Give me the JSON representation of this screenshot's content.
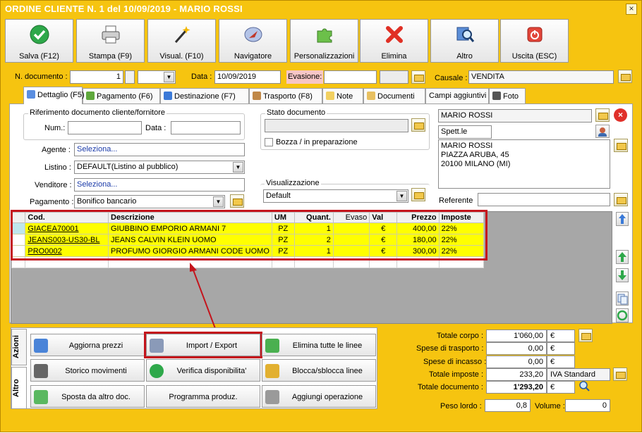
{
  "window": {
    "title": "ORDINE CLIENTE N. 1 del 10/09/2019 - MARIO ROSSI",
    "close": "×"
  },
  "toolbar": [
    {
      "label": "Salva (F12)",
      "icon": "check-icon"
    },
    {
      "label": "Stampa (F9)",
      "icon": "printer-icon"
    },
    {
      "label": "Visual. (F10)",
      "icon": "magic-wand-icon"
    },
    {
      "label": "Navigatore",
      "icon": "compass-icon"
    },
    {
      "label": "Personalizzazioni",
      "icon": "puzzle-icon"
    },
    {
      "label": "Elimina",
      "icon": "delete-x-icon"
    },
    {
      "label": "Altro",
      "icon": "magnifier-icon"
    },
    {
      "label": "Uscita (ESC)",
      "icon": "power-icon"
    }
  ],
  "header": {
    "ndoc_label": "N. documento :",
    "ndoc_value": "1",
    "data_label": "Data :",
    "data_value": "10/09/2019",
    "evasione_label": "Evasione:",
    "causale_label": "Causale :",
    "causale_value": "VENDITA"
  },
  "tabs": [
    "Dettaglio (F5)",
    "Pagamento (F6)",
    "Destinazione (F7)",
    "Trasporto (F8)",
    "Note",
    "Documenti",
    "Campi aggiuntivi",
    "Foto"
  ],
  "rif": {
    "title": "Riferimento documento cliente/fornitore",
    "num_label": "Num.:",
    "data_label": "Data :"
  },
  "fields": {
    "agente_label": "Agente :",
    "agente_value": "Seleziona...",
    "listino_label": "Listino :",
    "listino_value": "DEFAULT(Listino al pubblico)",
    "venditore_label": "Venditore :",
    "venditore_value": "Seleziona...",
    "pagamento_label": "Pagamento :",
    "pagamento_value": "Bonifico bancario"
  },
  "stato": {
    "title": "Stato documento",
    "bozza_label": "Bozza / in preparazione"
  },
  "visual": {
    "title": "Visualizzazione",
    "value": "Default"
  },
  "cliente": {
    "name": "MARIO ROSSI",
    "salutation": "Spett.le",
    "address_lines": [
      "MARIO ROSSI",
      "PIAZZA ARUBA, 45",
      "20100 MILANO (MI)"
    ],
    "referente_label": "Referente"
  },
  "grid": {
    "columns": [
      "Cod.",
      "Descrizione",
      "UM",
      "Quant.",
      "Evaso",
      "Val",
      "Prezzo",
      "Imposte"
    ],
    "rows": [
      [
        "GIACEA70001",
        "GIUBBINO EMPORIO ARMANI 7",
        "PZ",
        "1",
        "",
        "€",
        "400,00",
        "22%"
      ],
      [
        "JEANS003-US30-BL",
        "JEANS CALVIN KLEIN UOMO",
        "PZ",
        "2",
        "",
        "€",
        "180,00",
        "22%"
      ],
      [
        "PRO0002",
        "PROFUMO GIORGIO ARMANI CODE UOMO",
        "PZ",
        "1",
        "",
        "€",
        "300,00",
        "22%"
      ]
    ]
  },
  "actions": {
    "vtab_azioni": "Azioni",
    "vtab_altro": "Altro",
    "buttons": [
      {
        "label": "Aggiorna prezzi",
        "icon": "refresh-icon"
      },
      {
        "label": "Import / Export",
        "icon": "database-icon"
      },
      {
        "label": "Elimina tutte le linee",
        "icon": "recycle-icon"
      },
      {
        "label": "Storico movimenti",
        "icon": "binoculars-icon"
      },
      {
        "label": "Verifica disponibilita'",
        "icon": "check-icon"
      },
      {
        "label": "Blocca/sblocca linee",
        "icon": "lock-icon"
      },
      {
        "label": "Sposta da altro doc.",
        "icon": "move-doc-icon"
      },
      {
        "label": "Programma produz.",
        "icon": ""
      },
      {
        "label": "Aggiungi operazione",
        "icon": "tools-icon"
      }
    ]
  },
  "totals": {
    "corpo_label": "Totale corpo :",
    "corpo_value": "1'060,00",
    "corpo_cur": "€",
    "trasporto_label": "Spese di trasporto :",
    "trasporto_value": "0,00",
    "trasporto_cur": "€",
    "incasso_label": "Spese di incasso :",
    "incasso_value": "0,00",
    "incasso_cur": "€",
    "imposte_label": "Totale imposte :",
    "imposte_value": "233,20",
    "imposte_desc": "IVA Standard",
    "documento_label": "Totale documento :",
    "documento_value": "1'293,20",
    "documento_cur": "€",
    "peso_label": "Peso lordo :",
    "peso_value": "0,8",
    "volume_label": "Volume :",
    "volume_value": "0"
  },
  "colors": {
    "accent": "#f6c410",
    "highlight_row": "#ffff00",
    "annotation": "#c4141c"
  }
}
